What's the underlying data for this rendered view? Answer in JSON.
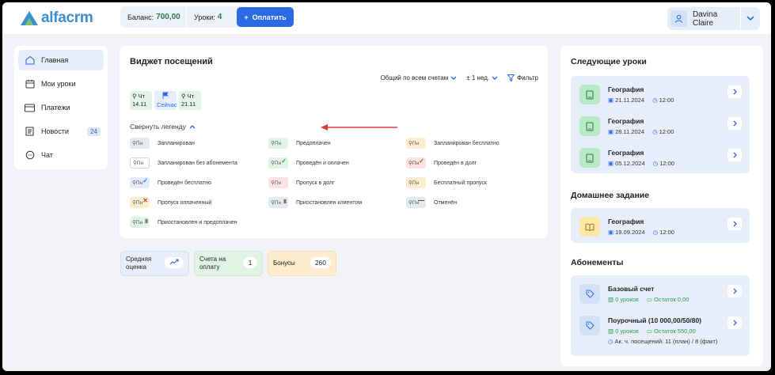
{
  "header": {
    "logo_text": "alfacrm",
    "balance_label": "Баланс:",
    "balance_value": "700,00",
    "lessons_label": "Уроки:",
    "lessons_value": "4",
    "pay_label": "Оплатить",
    "user_name": "Davina Claire"
  },
  "sidebar": {
    "items": [
      {
        "label": "Главная",
        "icon": "home-icon"
      },
      {
        "label": "Мои уроки",
        "icon": "calendar-icon"
      },
      {
        "label": "Платежи",
        "icon": "card-icon"
      },
      {
        "label": "Новости",
        "icon": "news-icon",
        "badge": "24"
      },
      {
        "label": "Чат",
        "icon": "chat-icon"
      }
    ]
  },
  "widget": {
    "title": "Виджет посещений",
    "filter_accounts": "Общий по всем счетам",
    "filter_period": "± 1 нед.",
    "filter_label": "Фильтр",
    "days": [
      {
        "top": "Чт",
        "bottom": "14.11"
      },
      {
        "top": "",
        "bottom": "Сейчас"
      },
      {
        "top": "Чт",
        "bottom": "21.11"
      }
    ],
    "collapse_label": "Свернуть легенду",
    "chip_text": "Пн",
    "legend": [
      "Запланирован",
      "Предоплачен",
      "Запланирован бесплатно",
      "Запланирован без абонемента",
      "Проведён и оплачен",
      "Проведён в долг",
      "Проведён бесплатно",
      "Пропуск в долг",
      "Бесплатный пропуск",
      "Пропуск оплаченный",
      "Приостановлен клиентом",
      "Отменён",
      "Приостановлен и предоплачен"
    ]
  },
  "stats": [
    {
      "label_1": "Средняя",
      "label_2": "оценка",
      "value": ""
    },
    {
      "label_1": "Счета на",
      "label_2": "оплату",
      "value": "1"
    },
    {
      "label_1": "Бонусы",
      "label_2": "",
      "value": "260"
    }
  ],
  "next_lessons": {
    "title": "Следующие уроки",
    "items": [
      {
        "subject": "География",
        "date": "21.11.2024",
        "time": "12:00"
      },
      {
        "subject": "География",
        "date": "28.11.2024",
        "time": "12:00"
      },
      {
        "subject": "География",
        "date": "05.12.2024",
        "time": "12:00"
      }
    ]
  },
  "homework": {
    "title": "Домашнее задание",
    "items": [
      {
        "subject": "География",
        "date": "19.09.2024",
        "time": "12:00"
      }
    ]
  },
  "subscriptions": {
    "title": "Абонементы",
    "items": [
      {
        "name": "Базовый счет",
        "lessons": "0 уроков",
        "rest": "Остаток 0,00",
        "extra": ""
      },
      {
        "name": "Поурочный (10 000,00/50/80)",
        "lessons": "0 уроков",
        "rest": "Остаток 550,00",
        "extra": "Ак. ч. посещений: 11 (план) / 8 (факт)"
      }
    ]
  },
  "colors": {
    "accent": "#2c6ae5",
    "logo": "#3b8ed0",
    "panel_bg": "#e8eef9",
    "lesson_icon_bg": "#b9e9c6",
    "homework_icon_bg": "#fbe7a8"
  }
}
